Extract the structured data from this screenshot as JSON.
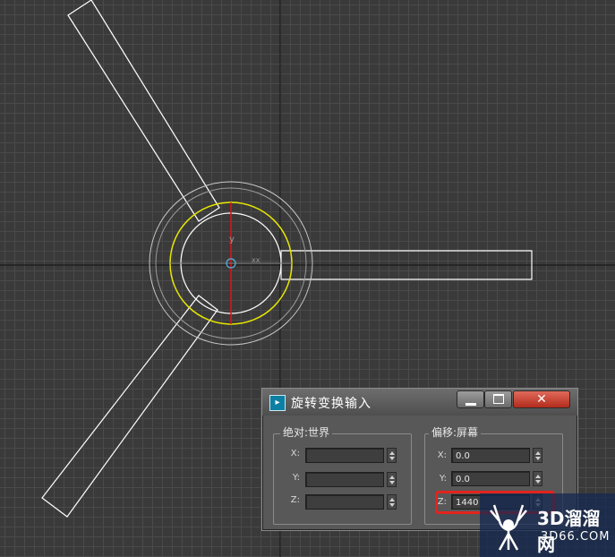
{
  "dialog": {
    "title": "旋转变换输入",
    "close_label": "✕",
    "groups": {
      "absolute": {
        "label": "绝对:世界",
        "x_label": "X:",
        "x_value": "",
        "y_label": "Y:",
        "y_value": "",
        "z_label": "Z:",
        "z_value": ""
      },
      "offset": {
        "label": "偏移:屏幕",
        "x_label": "X:",
        "x_value": "0.0",
        "y_label": "Y:",
        "y_value": "0.0",
        "z_label": "Z:",
        "z_value": "1440"
      }
    },
    "highlight_color": "#e3231d"
  },
  "viewport": {
    "background": "#3a3a3a",
    "grid_color": "#4a4a4a",
    "object_color": "#ffffff",
    "gizmo_colors": {
      "ring": "#e8e800",
      "x_axis": "#e01010",
      "y_axis": "#7a7a7a",
      "outer_ring": "#c8c8c8"
    },
    "gizmo_y_label": "y",
    "gizmo_x_label": "xx"
  },
  "watermark": {
    "logo": "3D溜溜网",
    "domain": "3D66.COM"
  }
}
